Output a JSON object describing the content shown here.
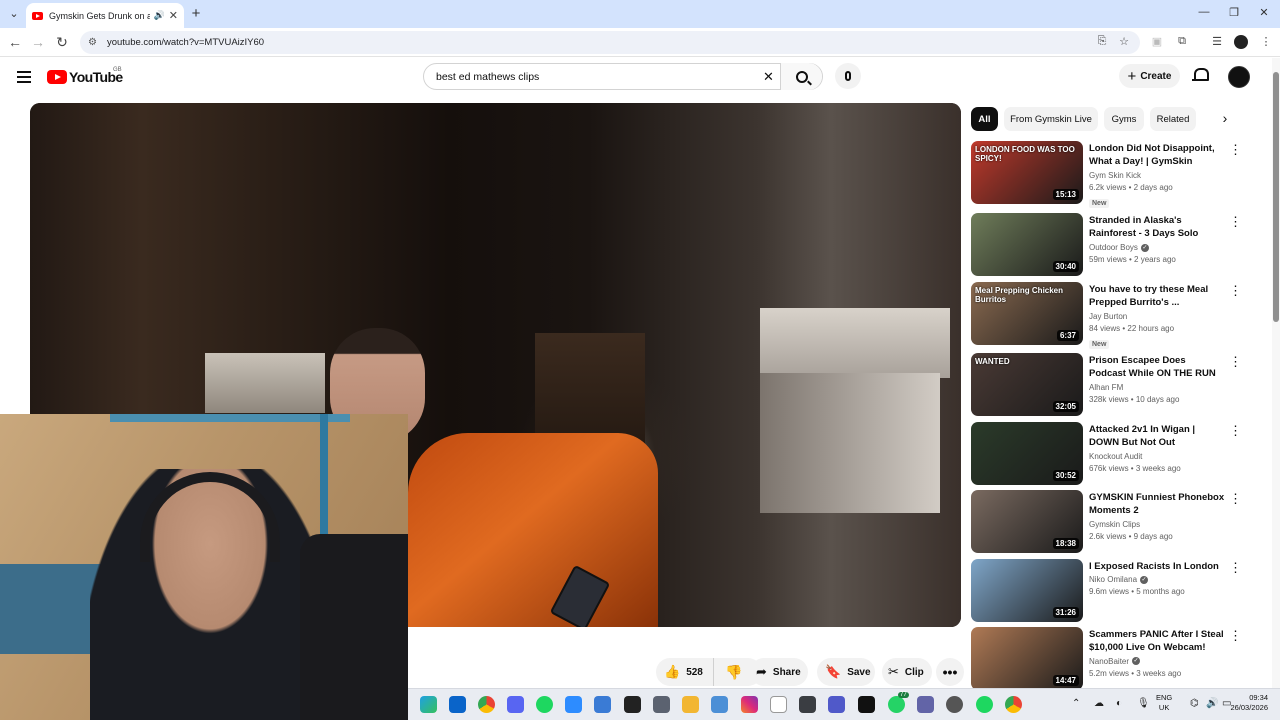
{
  "browser": {
    "tab_title": "Gymskin Gets Drunk on a Fl",
    "url": "youtube.com/watch?v=MTVUAizIY60"
  },
  "youtube": {
    "logo_text": "YouTube",
    "country_code": "GB",
    "search_value": "best ed mathews clips",
    "create_label": "Create"
  },
  "actions": {
    "like_count": "528",
    "share_label": "Share",
    "save_label": "Save",
    "clip_label": "Clip"
  },
  "chips": [
    "All",
    "From Gymskin Live",
    "Gyms",
    "Related"
  ],
  "related": [
    {
      "title": "London Did Not Disappoint, What a Day! | GymSkin",
      "channel": "Gym Skin Kick",
      "verified": false,
      "meta": "6.2k views • 2 days ago",
      "badge": "New",
      "duration": "15:13",
      "overlay": "LONDON FOOD WAS TOO SPICY!",
      "thumb_color": "#c0392b"
    },
    {
      "title": "Stranded in Alaska's Rainforest - 3 Days Solo camping",
      "channel": "Outdoor Boys",
      "verified": true,
      "meta": "59m views • 2 years ago",
      "badge": "",
      "duration": "30:40",
      "overlay": "",
      "thumb_color": "#6f7d5a"
    },
    {
      "title": "You have to try these Meal Prepped Burrito's ...",
      "channel": "Jay Burton",
      "verified": false,
      "meta": "84 views • 22 hours ago",
      "badge": "New",
      "duration": "6:37",
      "overlay": "Meal Prepping Chicken Burritos",
      "thumb_color": "#8a6a50"
    },
    {
      "title": "Prison Escapee Does Podcast While ON THE RUN",
      "channel": "Alhan FM",
      "verified": false,
      "meta": "328k views • 10 days ago",
      "badge": "",
      "duration": "32:05",
      "overlay": "WANTED",
      "thumb_color": "#4a3a35"
    },
    {
      "title": "Attacked 2v1 In Wigan | DOWN But Not Out",
      "channel": "Knockout Audit",
      "verified": false,
      "meta": "676k views • 3 weeks ago",
      "badge": "",
      "duration": "30:52",
      "overlay": "",
      "thumb_color": "#2b3b2a"
    },
    {
      "title": "GYMSKIN Funniest Phonebox Moments 2",
      "channel": "Gymskin Clips",
      "verified": false,
      "meta": "2.6k views • 9 days ago",
      "badge": "",
      "duration": "18:38",
      "overlay": "",
      "thumb_color": "#7a6a60"
    },
    {
      "title": "I Exposed Racists In London",
      "channel": "Niko Omilana",
      "verified": true,
      "meta": "9.6m views • 5 months ago",
      "badge": "",
      "duration": "31:26",
      "overlay": "",
      "thumb_color": "#7fa6c9"
    },
    {
      "title": "Scammers PANIC After I Steal $10,000 Live On Webcam!",
      "channel": "NanoBaiter",
      "verified": true,
      "meta": "5.2m views • 3 weeks ago",
      "badge": "",
      "duration": "14:47",
      "overlay": "",
      "thumb_color": "#b07a55"
    }
  ],
  "taskbar": {
    "lang_line1": "ENG",
    "lang_line2": "UK",
    "time": "09:34",
    "date": "26/03/2026",
    "badge": "77"
  },
  "colors": {
    "youtube_red": "#ff0000",
    "tab_strip": "#d3e3fd"
  }
}
